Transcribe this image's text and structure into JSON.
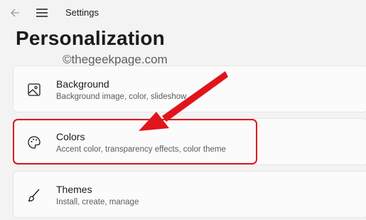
{
  "titlebar": {
    "app_title": "Settings",
    "back_icon": "back-arrow-icon",
    "menu_icon": "hamburger-menu-icon"
  },
  "page": {
    "title": "Personalization",
    "watermark": "©thegeekpage.com"
  },
  "cards": [
    {
      "title": "Background",
      "description": "Background image, color, slideshow",
      "icon": "image-icon"
    },
    {
      "title": "Colors",
      "description": "Accent color, transparency effects, color theme",
      "icon": "palette-icon"
    },
    {
      "title": "Themes",
      "description": "Install, create, manage",
      "icon": "brush-icon"
    }
  ],
  "annotation": {
    "color": "#e0151b"
  }
}
